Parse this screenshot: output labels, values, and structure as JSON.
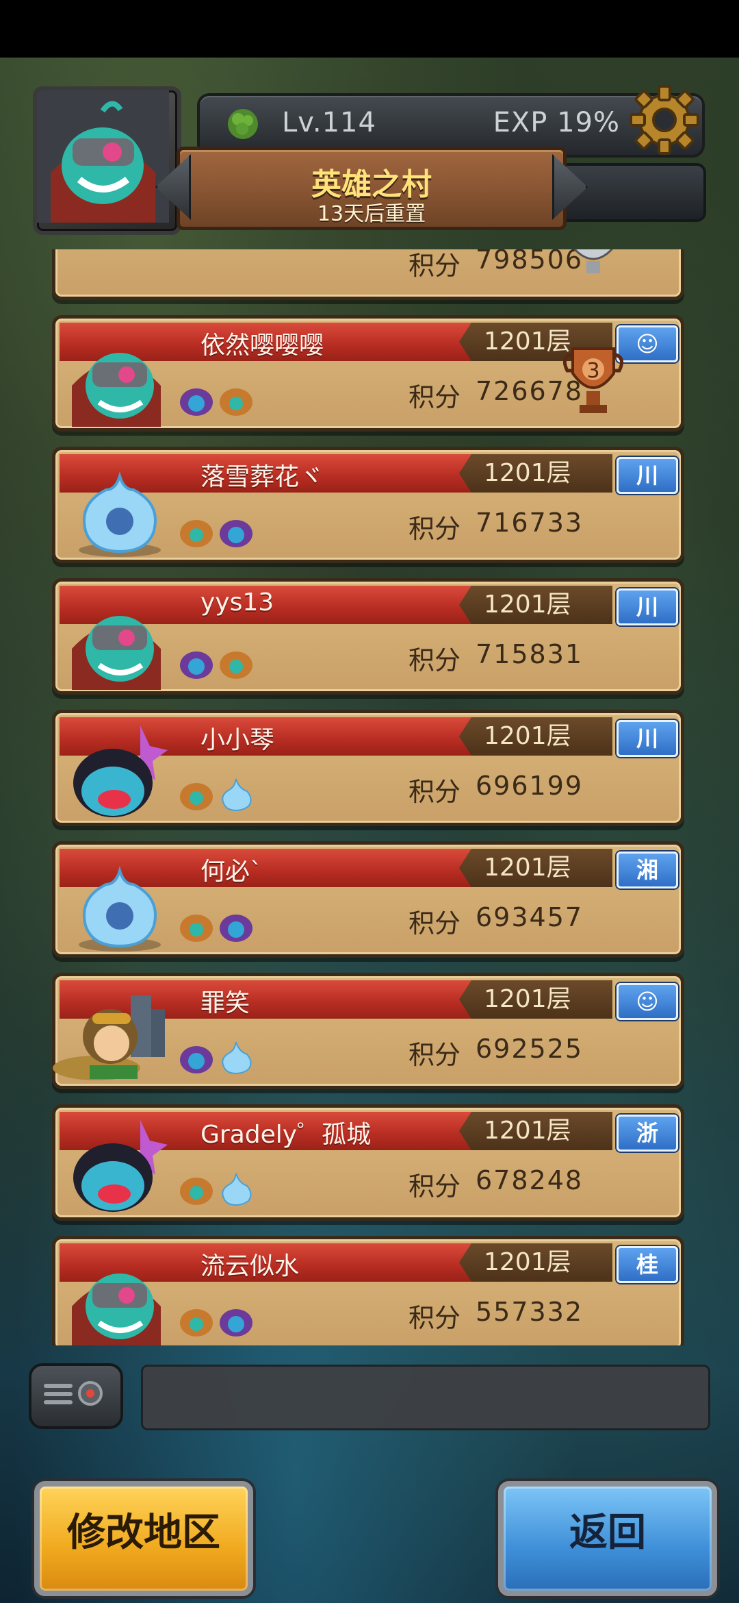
{
  "header": {
    "level": "Lv.114",
    "exp": "EXP 19%",
    "title": "英雄之村",
    "subtitle": "13天后重置"
  },
  "ranking": {
    "score_label": "积分",
    "partial_top": {
      "score": "798506"
    },
    "players": [
      {
        "name": "依然嘤嘤嘤",
        "floor": "1201层",
        "score": "726678",
        "region": "☺",
        "trophy": "3"
      },
      {
        "name": "落雪葬花ヾ",
        "floor": "1201层",
        "score": "716733",
        "region": "川"
      },
      {
        "name": "yys13",
        "floor": "1201层",
        "score": "715831",
        "region": "川"
      },
      {
        "name": "小小琴",
        "floor": "1201层",
        "score": "696199",
        "region": "川"
      },
      {
        "name": "何必`",
        "floor": "1201层",
        "score": "693457",
        "region": "湘"
      },
      {
        "name": "罪笑",
        "floor": "1201层",
        "score": "692525",
        "region": "☺"
      },
      {
        "name": "Gradely゜孤城",
        "floor": "1201层",
        "score": "678248",
        "region": "浙"
      },
      {
        "name": "流云似水",
        "floor": "1201层",
        "score": "557332",
        "region": "桂"
      }
    ]
  },
  "buttons": {
    "change_region": "修改地区",
    "back": "返回"
  }
}
